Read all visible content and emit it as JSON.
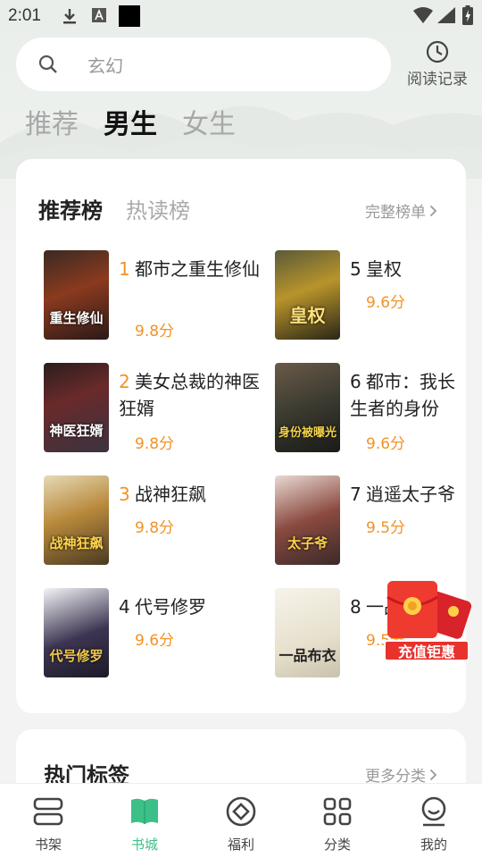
{
  "status_bar": {
    "time": "2:01"
  },
  "search": {
    "placeholder": "玄幻"
  },
  "history": {
    "label": "阅读记录"
  },
  "gender_tabs": [
    {
      "label": "推荐",
      "active": false
    },
    {
      "label": "男生",
      "active": true
    },
    {
      "label": "女生",
      "active": false
    }
  ],
  "ranking": {
    "tabs": [
      {
        "label": "推荐榜",
        "active": true
      },
      {
        "label": "热读榜",
        "active": false
      }
    ],
    "full_list_label": "完整榜单",
    "books": [
      {
        "rank": "1",
        "title": "都市之重生修仙",
        "score": "9.8分",
        "cover_text": "重生修仙"
      },
      {
        "rank": "2",
        "title": "美女总裁的神医狂婿",
        "score": "9.8分",
        "cover_text": "神医狂婿"
      },
      {
        "rank": "3",
        "title": "战神狂飙",
        "score": "9.8分",
        "cover_text": "战神狂飙"
      },
      {
        "rank": "4",
        "title": "代号修罗",
        "score": "9.6分",
        "cover_text": "代号修罗"
      },
      {
        "rank": "5",
        "title": "皇权",
        "score": "9.6分",
        "cover_text": "皇权"
      },
      {
        "rank": "6",
        "title": "都市：我长生者的身份被…",
        "score": "9.6分",
        "cover_text": "身份被曝光"
      },
      {
        "rank": "7",
        "title": "逍遥太子爷",
        "score": "9.5分",
        "cover_text": "太子爷"
      },
      {
        "rank": "8",
        "title": "一品布衣",
        "score": "9.5分",
        "cover_text": "一品布衣"
      }
    ]
  },
  "hot_tags": {
    "title": "热门标签",
    "more_label": "更多分类"
  },
  "promo": {
    "label": "充值钜惠"
  },
  "bottom_nav": [
    {
      "label": "书架",
      "icon": "bookshelf-icon",
      "active": false
    },
    {
      "label": "书城",
      "icon": "book-store-icon",
      "active": true
    },
    {
      "label": "福利",
      "icon": "welfare-icon",
      "active": false
    },
    {
      "label": "分类",
      "icon": "category-icon",
      "active": false
    },
    {
      "label": "我的",
      "icon": "profile-icon",
      "active": false
    }
  ],
  "colors": {
    "accent": "#3dbf88",
    "score": "#f39226",
    "promo_red": "#e8322c"
  }
}
